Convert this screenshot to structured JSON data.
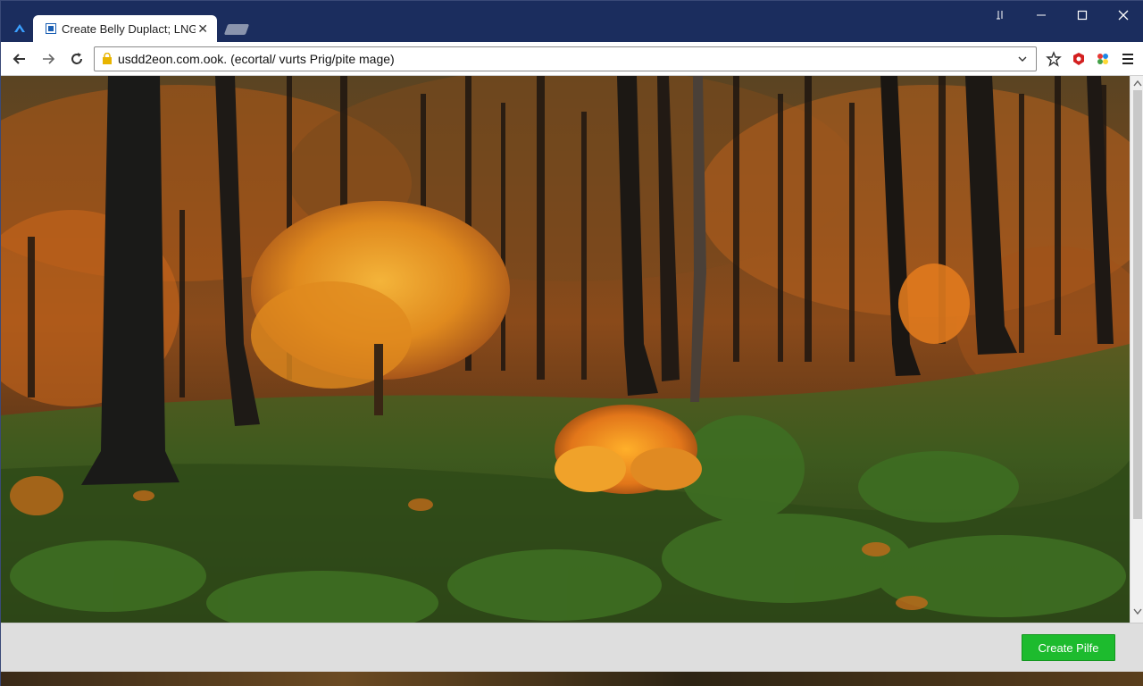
{
  "window": {
    "tab_title": "Create Belly Duplact; LNG",
    "controls": {
      "pin_icon": "pin-icon",
      "minimize_icon": "minimize-icon",
      "maximize_icon": "maximize-icon",
      "close_icon": "close-icon"
    }
  },
  "toolbar": {
    "url": "usdd2eon.com.ook. (ecortal/ vurts Prig/pite mage)",
    "icons": [
      "back-icon",
      "forward-icon",
      "reload-icon",
      "lock-icon",
      "dropdown-icon",
      "star-icon",
      "extension-icon",
      "profile-icon",
      "menu-icon"
    ]
  },
  "content": {
    "image_subject": "forest-photo"
  },
  "footer": {
    "create_label": "Create Pilfe"
  },
  "colors": {
    "titlebar": "#1b2d5e",
    "accent_button": "#1dbb2e",
    "footer": "#dedede"
  }
}
